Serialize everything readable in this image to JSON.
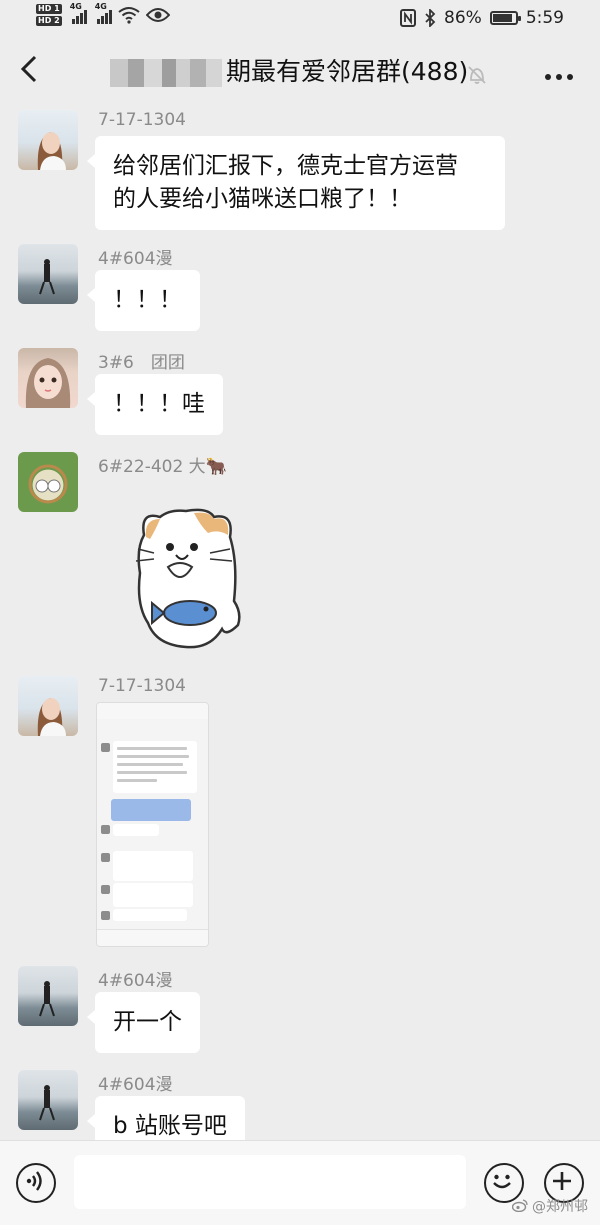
{
  "status_bar": {
    "hd1": "HD 1",
    "hd2": "HD 2",
    "network1": "4G",
    "network2": "4G",
    "battery_percent": "86%",
    "battery_level": 0.86,
    "time": "5:59"
  },
  "header": {
    "title": "期最有爱邻居群(488)"
  },
  "messages": [
    {
      "sender": "7-17-1304",
      "text": "给邻居们汇报下，德克士官方运营\n的人要给小猫咪送口粮了！！"
    },
    {
      "sender": "4#604漫",
      "text": "！！！"
    },
    {
      "sender": "3#6　团团",
      "text": "！！！哇"
    },
    {
      "sender": "6#22-402 大🐂",
      "sticker": "cat-with-fish"
    },
    {
      "sender": "7-17-1304",
      "image": "shared-chat-screenshot"
    },
    {
      "sender": "4#604漫",
      "text": "开一个"
    },
    {
      "sender": "4#604漫",
      "text": "b 站账号吧"
    }
  ],
  "watermark": "@郑州邨"
}
